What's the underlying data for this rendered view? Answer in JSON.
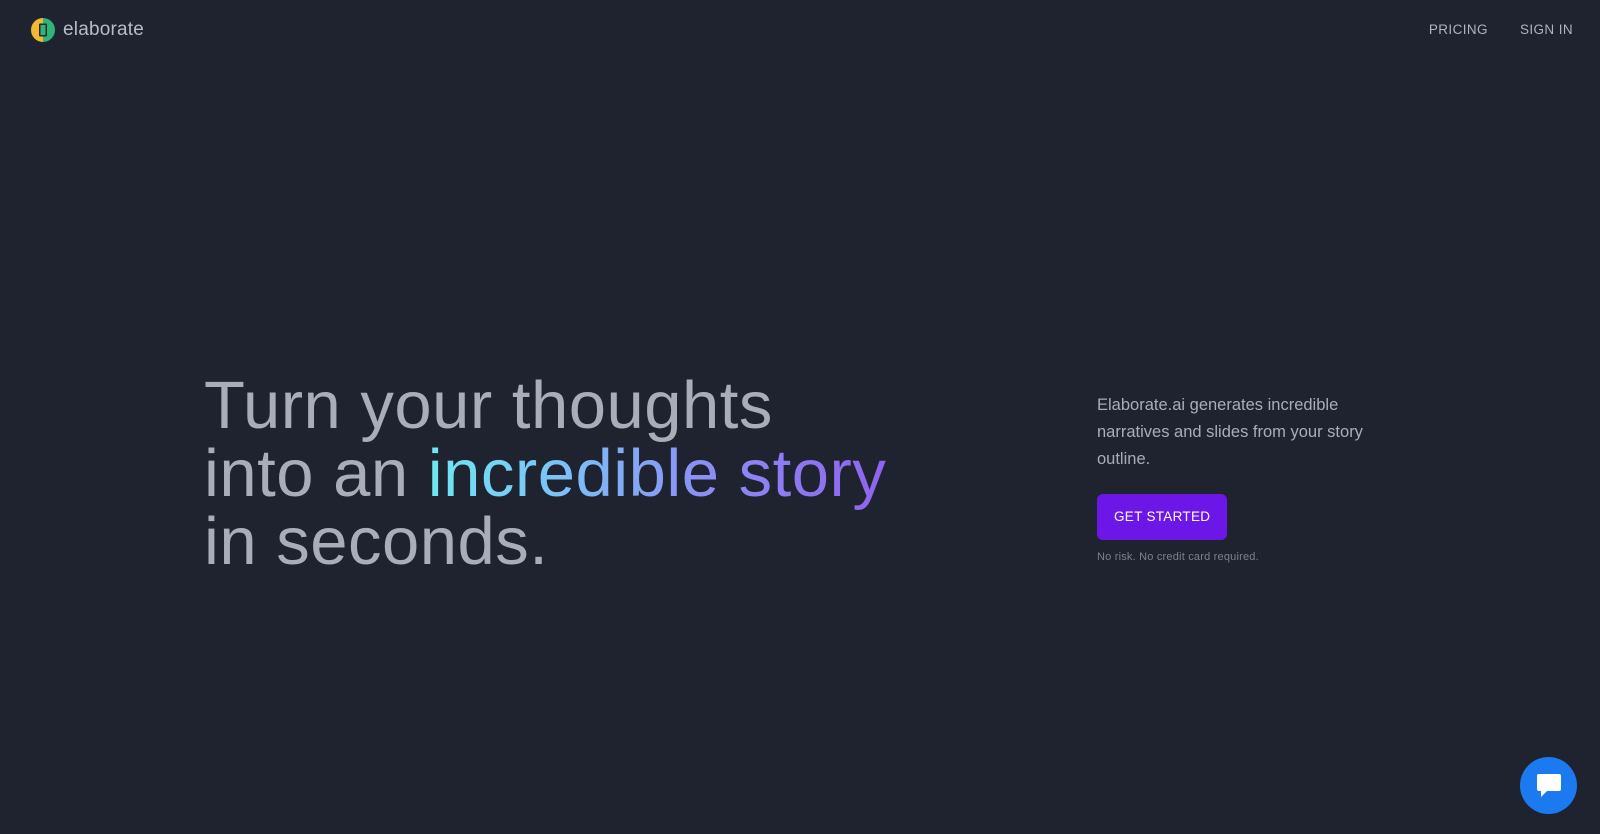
{
  "header": {
    "brand_name": "elaborate",
    "logo_icon": "elaborate-logo-icon",
    "nav": [
      {
        "label": "PRICING"
      },
      {
        "label": "SIGN IN"
      }
    ]
  },
  "hero": {
    "line1": "Turn your thoughts",
    "line2_prefix": "into an ",
    "line2_highlight": "incredible story",
    "line3": "in seconds."
  },
  "aside": {
    "description": "Elaborate.ai generates incredible narratives and slides from your story outline.",
    "cta_label": "GET STARTED",
    "note": "No risk. No credit card required."
  },
  "chat": {
    "icon": "chat-bubble-icon"
  },
  "colors": {
    "background": "#1f2330",
    "cta": "#6c17e8",
    "chat": "#1c7af0",
    "gradient_start": "#6ee7f2",
    "gradient_end": "#8f63ee"
  }
}
